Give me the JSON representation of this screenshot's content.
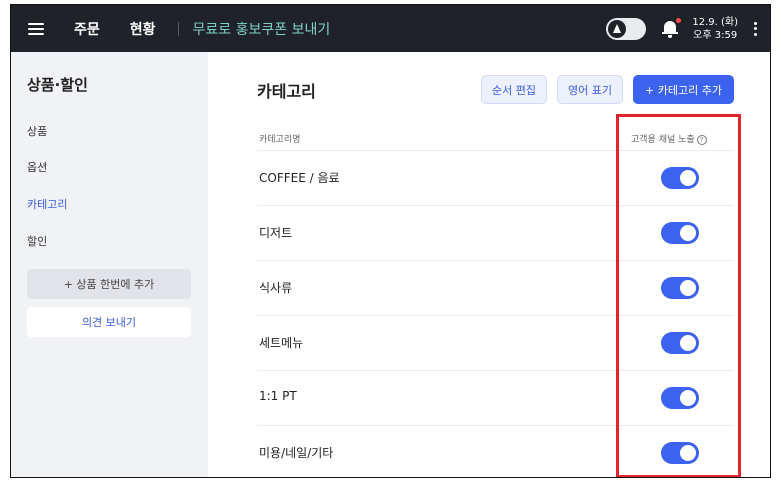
{
  "topbar": {
    "nav": [
      "주문",
      "현황"
    ],
    "promo_link": "무료로 홍보쿠폰 보내기",
    "clock": {
      "date": "12.9. (화)",
      "time": "오후 3:59"
    }
  },
  "sidebar": {
    "title": "상품·할인",
    "items": [
      {
        "label": "상품",
        "active": false
      },
      {
        "label": "옵션",
        "active": false
      },
      {
        "label": "카테고리",
        "active": true
      },
      {
        "label": "할인",
        "active": false
      }
    ],
    "bulk_add_button": "+ 상품 한번에 추가",
    "feedback_button": "의견 보내기"
  },
  "main": {
    "title": "카테고리",
    "buttons": {
      "reorder": "순서 편집",
      "english": "영어 표기",
      "add": "+ 카테고리 추가"
    },
    "columns": {
      "name": "카테고리명",
      "channel": "고객용 채널 노출"
    },
    "rows": [
      {
        "name": "COFFEE / 음료",
        "visible": true
      },
      {
        "name": "디저트",
        "visible": true
      },
      {
        "name": "식사류",
        "visible": true
      },
      {
        "name": "세트메뉴",
        "visible": true
      },
      {
        "name": "1:1 PT",
        "visible": true
      },
      {
        "name": "미용/네일/기타",
        "visible": true
      }
    ]
  },
  "colors": {
    "accent": "#3c63f0",
    "highlight": "#e3262e",
    "topbar": "#1f2228",
    "promo": "#7fd1c6"
  },
  "icons": [
    "menu-icon",
    "dark-mode-icon",
    "bell-icon",
    "more-vertical-icon",
    "help-icon"
  ]
}
